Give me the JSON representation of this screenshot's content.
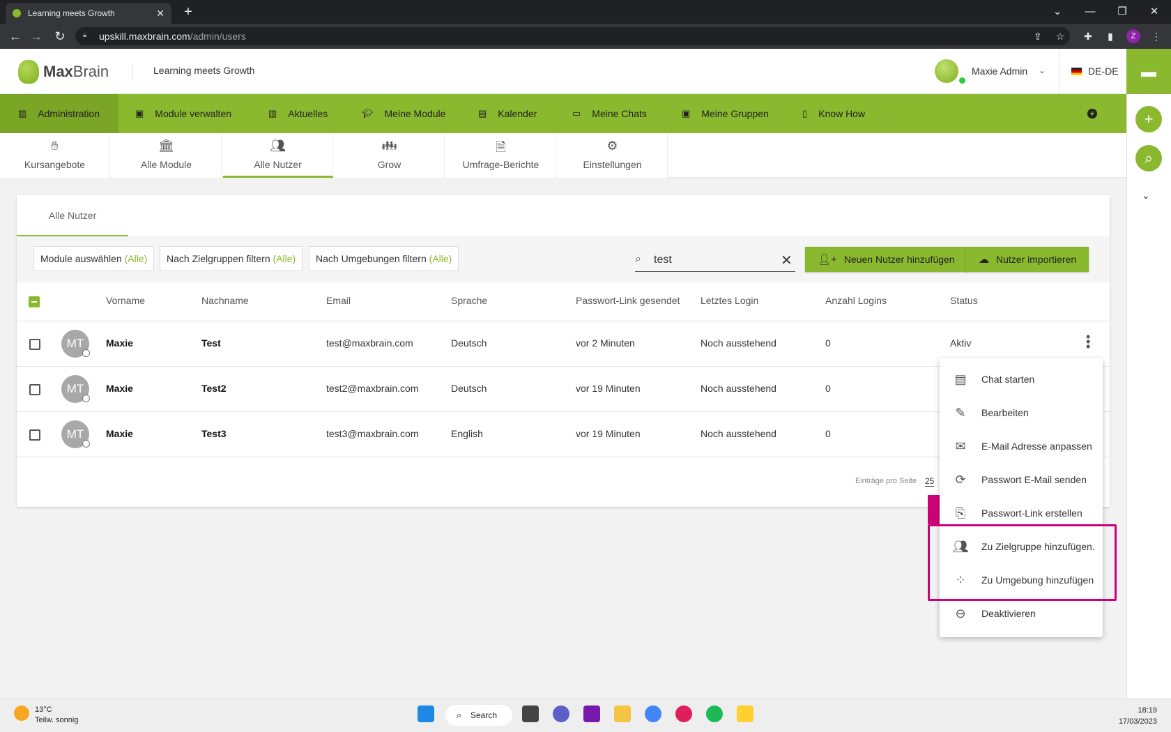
{
  "browser": {
    "tab_title": "Learning meets Growth",
    "url_host": "upskill.maxbrain.com",
    "url_path": "/admin/users",
    "profile_initial": "Z"
  },
  "header": {
    "logo_max": "Max",
    "logo_brain": "Brain",
    "tagline": "Learning meets Growth",
    "user_name": "Maxie Admin",
    "language": "DE-DE"
  },
  "main_nav": [
    {
      "label": "Administration",
      "icon": "grid-icon"
    },
    {
      "label": "Module verwalten",
      "icon": "folder-icon"
    },
    {
      "label": "Aktuelles",
      "icon": "news-icon"
    },
    {
      "label": "Meine Module",
      "icon": "graduation-icon"
    },
    {
      "label": "Kalender",
      "icon": "calendar-icon"
    },
    {
      "label": "Meine Chats",
      "icon": "chat-icon"
    },
    {
      "label": "Meine Gruppen",
      "icon": "group-icon"
    },
    {
      "label": "Know How",
      "icon": "book-icon"
    }
  ],
  "sub_tabs": [
    {
      "label": "Kursangebote",
      "icon": "hand-book-icon"
    },
    {
      "label": "Alle Module",
      "icon": "institution-icon"
    },
    {
      "label": "Alle Nutzer",
      "icon": "users-icon"
    },
    {
      "label": "Grow",
      "icon": "people-icon"
    },
    {
      "label": "Umfrage-Berichte",
      "icon": "document-icon"
    },
    {
      "label": "Einstellungen",
      "icon": "gears-icon"
    }
  ],
  "card": {
    "tab_label": "Alle Nutzer",
    "filters": [
      {
        "label": "Module auswählen",
        "suffix": "(Alle)"
      },
      {
        "label": "Nach Zielgruppen filtern",
        "suffix": "(Alle)"
      },
      {
        "label": "Nach Umgebungen filtern",
        "suffix": "(Alle)"
      }
    ],
    "search_value": "test",
    "add_user_label": "Neuen Nutzer hinzufügen",
    "import_label": "Nutzer importieren"
  },
  "table": {
    "columns": [
      "Vorname",
      "Nachname",
      "Email",
      "Sprache",
      "Passwort-Link gesendet",
      "Letztes Login",
      "Anzahl Logins",
      "Status"
    ],
    "rows": [
      {
        "initials": "MT",
        "first": "Maxie",
        "last": "Test",
        "email": "test@maxbrain.com",
        "lang": "Deutsch",
        "sent": "vor 2 Minuten",
        "login": "Noch ausstehend",
        "count": "0",
        "status": "Aktiv"
      },
      {
        "initials": "MT",
        "first": "Maxie",
        "last": "Test2",
        "email": "test2@maxbrain.com",
        "lang": "Deutsch",
        "sent": "vor 19 Minuten",
        "login": "Noch ausstehend",
        "count": "0",
        "status": ""
      },
      {
        "initials": "MT",
        "first": "Maxie",
        "last": "Test3",
        "email": "test3@maxbrain.com",
        "lang": "English",
        "sent": "vor 19 Minuten",
        "login": "Noch ausstehend",
        "count": "0",
        "status": ""
      }
    ],
    "per_page_label": "Einträge pro Seite",
    "per_page_value": "25"
  },
  "context_menu": [
    {
      "label": "Chat starten",
      "icon": "message-icon"
    },
    {
      "label": "Bearbeiten",
      "icon": "pencil-icon"
    },
    {
      "label": "E-Mail Adresse anpassen",
      "icon": "mail-icon"
    },
    {
      "label": "Passwort E-Mail senden",
      "icon": "refresh-icon"
    },
    {
      "label": "Passwort-Link erstellen",
      "icon": "copy-icon"
    },
    {
      "label": "Zu Zielgruppe hinzufügen.",
      "icon": "group-add-icon"
    },
    {
      "label": "Zu Umgebung hinzufügen",
      "icon": "dots-grid-icon"
    },
    {
      "label": "Deaktivieren",
      "icon": "minus-circle-icon"
    }
  ],
  "taskbar": {
    "temp": "13°C",
    "weather": "Teilw. sonnig",
    "search_label": "Search",
    "time": "18:19",
    "date": "17/03/2023"
  },
  "colors": {
    "accent": "#8ab82e",
    "highlight": "#cc0077"
  }
}
